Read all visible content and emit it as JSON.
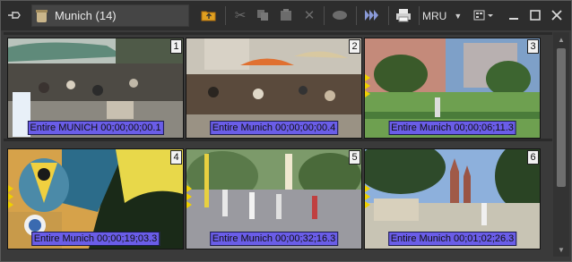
{
  "window": {
    "title": "Munich (14)"
  },
  "toolbar": {
    "mru_label": "MRU"
  },
  "clips": [
    {
      "index": "1",
      "caption": "Entire MUNICH 00;00;00;00.1",
      "markers": 0
    },
    {
      "index": "2",
      "caption": "Entire Munich 00;00;00;00.4",
      "markers": 0
    },
    {
      "index": "3",
      "caption": "Entire Munich 00;00;06;11.3",
      "markers": 3
    },
    {
      "index": "4",
      "caption": "Entire Munich 00;00;19;03.3",
      "markers": 3
    },
    {
      "index": "5",
      "caption": "Entire Munich 00;00;32;16.3",
      "markers": 3
    },
    {
      "index": "6",
      "caption": "Entire Munich 00;01;02;26.3",
      "markers": 3
    }
  ],
  "colors": {
    "caption_bg": "#6a5de8",
    "marker": "#f0d000",
    "panel_bg": "#3a3a3a"
  },
  "icons": [
    "pin-icon",
    "bin-icon",
    "up-folder-icon",
    "cut-icon",
    "copy-icon",
    "paste-icon",
    "delete-icon",
    "preview-icon",
    "play-icon",
    "print-icon",
    "view-mode-icon",
    "minimize-icon",
    "maximize-icon",
    "close-icon"
  ]
}
